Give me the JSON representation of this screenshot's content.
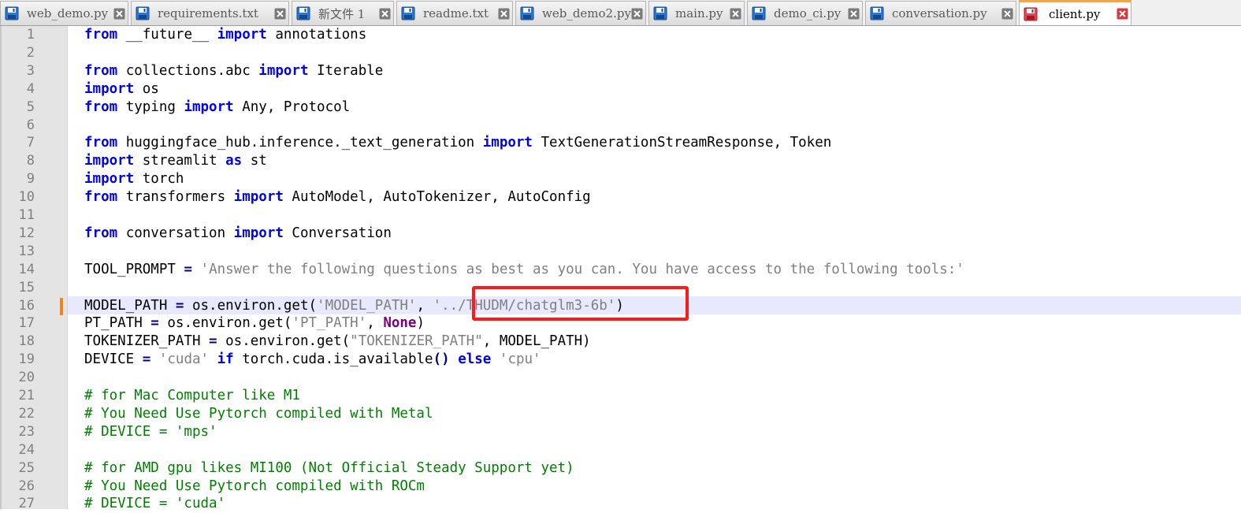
{
  "tabs": [
    {
      "label": "web_demo.py",
      "icon": "floppy-disk-icon",
      "active": false
    },
    {
      "label": "requirements.txt",
      "icon": "floppy-disk-icon",
      "active": false
    },
    {
      "label": "新文件 1",
      "icon": "floppy-disk-icon",
      "active": false
    },
    {
      "label": "readme.txt",
      "icon": "floppy-disk-icon",
      "active": false
    },
    {
      "label": "web_demo2.py",
      "icon": "floppy-disk-icon",
      "active": false
    },
    {
      "label": "main.py",
      "icon": "floppy-disk-icon",
      "active": false
    },
    {
      "label": "demo_ci.py",
      "icon": "floppy-disk-icon",
      "active": false
    },
    {
      "label": "conversation.py",
      "icon": "floppy-disk-icon",
      "active": false
    },
    {
      "label": "client.py",
      "icon": "unsaved-floppy-disk-icon",
      "active": true
    }
  ],
  "colors": {
    "keyword": "#0000ff",
    "keyword_alt": "#800080",
    "string": "#808080",
    "comment": "#008000",
    "current_line": "#e8e8ff",
    "highlight_box": "#ff1a1a",
    "change_marker": "#f58220",
    "active_tab_accent": "#f3a54a"
  },
  "editor": {
    "current_line": 16,
    "highlighted_text": "'../THUDM/chatglm3-6b'",
    "lines": [
      {
        "n": "1",
        "tokens": [
          {
            "t": "from",
            "c": "kw"
          },
          {
            "t": " __future__ "
          },
          {
            "t": "import",
            "c": "kw"
          },
          {
            "t": " annotations"
          }
        ]
      },
      {
        "n": "2",
        "tokens": []
      },
      {
        "n": "3",
        "tokens": [
          {
            "t": "from",
            "c": "kw"
          },
          {
            "t": " collections.abc "
          },
          {
            "t": "import",
            "c": "kw"
          },
          {
            "t": " Iterable"
          }
        ]
      },
      {
        "n": "4",
        "tokens": [
          {
            "t": "import",
            "c": "kw"
          },
          {
            "t": " os"
          }
        ]
      },
      {
        "n": "5",
        "tokens": [
          {
            "t": "from",
            "c": "kw"
          },
          {
            "t": " typing "
          },
          {
            "t": "import",
            "c": "kw"
          },
          {
            "t": " Any, Protocol"
          }
        ]
      },
      {
        "n": "6",
        "tokens": []
      },
      {
        "n": "7",
        "tokens": [
          {
            "t": "from",
            "c": "kw"
          },
          {
            "t": " huggingface_hub.inference._text_generation "
          },
          {
            "t": "import",
            "c": "kw"
          },
          {
            "t": " TextGenerationStreamResponse, Token"
          }
        ]
      },
      {
        "n": "8",
        "tokens": [
          {
            "t": "import",
            "c": "kw"
          },
          {
            "t": " streamlit "
          },
          {
            "t": "as",
            "c": "kw"
          },
          {
            "t": " st"
          }
        ]
      },
      {
        "n": "9",
        "tokens": [
          {
            "t": "import",
            "c": "kw"
          },
          {
            "t": " torch"
          }
        ]
      },
      {
        "n": "10",
        "tokens": [
          {
            "t": "from",
            "c": "kw"
          },
          {
            "t": " transformers "
          },
          {
            "t": "import",
            "c": "kw"
          },
          {
            "t": " AutoModel, AutoTokenizer, AutoConfig"
          }
        ]
      },
      {
        "n": "11",
        "tokens": []
      },
      {
        "n": "12",
        "tokens": [
          {
            "t": "from",
            "c": "kw"
          },
          {
            "t": " conversation "
          },
          {
            "t": "import",
            "c": "kw"
          },
          {
            "t": " Conversation"
          }
        ]
      },
      {
        "n": "13",
        "tokens": []
      },
      {
        "n": "14",
        "tokens": [
          {
            "t": "TOOL_PROMPT "
          },
          {
            "t": "=",
            "c": "op"
          },
          {
            "t": " "
          },
          {
            "t": "'Answer the following questions as best as you can. You have access to the following tools:'",
            "c": "str"
          }
        ]
      },
      {
        "n": "15",
        "tokens": []
      },
      {
        "n": "16",
        "tokens": [
          {
            "t": "MODEL_PATH "
          },
          {
            "t": "=",
            "c": "op"
          },
          {
            "t": " os.environ.get("
          },
          {
            "t": "'MODEL_PATH'",
            "c": "str"
          },
          {
            "t": ", "
          },
          {
            "t": "'../THUDM/chatglm3-6b'",
            "c": "str"
          },
          {
            "t": ")"
          }
        ]
      },
      {
        "n": "17",
        "tokens": [
          {
            "t": "PT_PATH "
          },
          {
            "t": "=",
            "c": "op"
          },
          {
            "t": " os.environ.get("
          },
          {
            "t": "'PT_PATH'",
            "c": "str"
          },
          {
            "t": ", "
          },
          {
            "t": "None",
            "c": "kw2"
          },
          {
            "t": ")"
          }
        ]
      },
      {
        "n": "18",
        "tokens": [
          {
            "t": "TOKENIZER_PATH "
          },
          {
            "t": "=",
            "c": "op"
          },
          {
            "t": " os.environ.get("
          },
          {
            "t": "\"TOKENIZER_PATH\"",
            "c": "str"
          },
          {
            "t": ", MODEL_PATH)"
          }
        ]
      },
      {
        "n": "19",
        "tokens": [
          {
            "t": "DEVICE "
          },
          {
            "t": "=",
            "c": "op"
          },
          {
            "t": " "
          },
          {
            "t": "'cuda'",
            "c": "str"
          },
          {
            "t": " "
          },
          {
            "t": "if",
            "c": "kw"
          },
          {
            "t": " torch.cuda.is_available"
          },
          {
            "t": "()",
            "c": "op"
          },
          {
            "t": " "
          },
          {
            "t": "else",
            "c": "kw"
          },
          {
            "t": " "
          },
          {
            "t": "'cpu'",
            "c": "str"
          }
        ]
      },
      {
        "n": "20",
        "tokens": []
      },
      {
        "n": "21",
        "tokens": [
          {
            "t": "# for Mac Computer like M1",
            "c": "cmt"
          }
        ]
      },
      {
        "n": "22",
        "tokens": [
          {
            "t": "# You Need Use Pytorch compiled with Metal",
            "c": "cmt"
          }
        ]
      },
      {
        "n": "23",
        "tokens": [
          {
            "t": "# DEVICE = 'mps'",
            "c": "cmt"
          }
        ]
      },
      {
        "n": "24",
        "tokens": []
      },
      {
        "n": "25",
        "tokens": [
          {
            "t": "# for AMD gpu likes MI100 (Not Official Steady Support yet)",
            "c": "cmt"
          }
        ]
      },
      {
        "n": "26",
        "tokens": [
          {
            "t": "# You Need Use Pytorch compiled with ROCm",
            "c": "cmt"
          }
        ]
      },
      {
        "n": "27",
        "tokens": [
          {
            "t": "# DEVICE = 'cuda'",
            "c": "cmt"
          }
        ]
      }
    ]
  }
}
